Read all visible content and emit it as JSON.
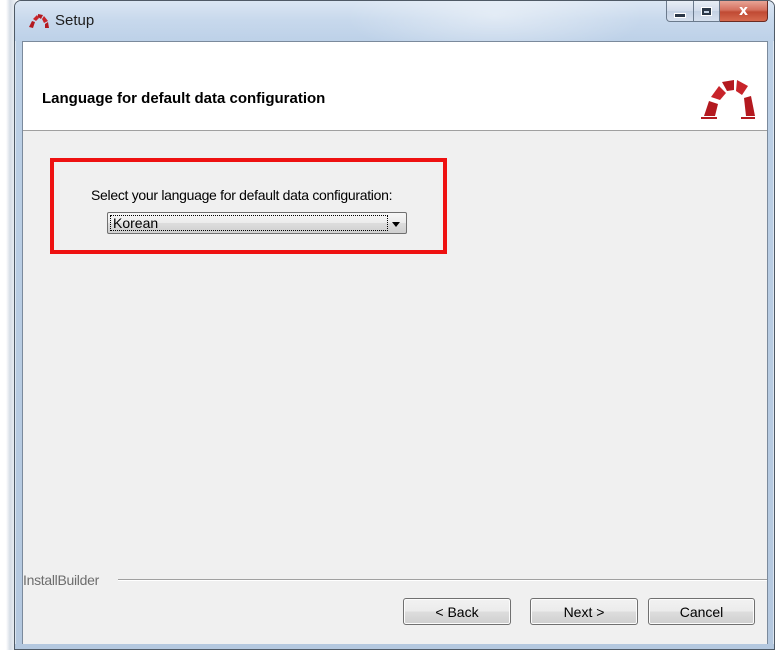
{
  "window": {
    "title": "Setup",
    "close_glyph": "x",
    "icon": "redmine-arc-icon"
  },
  "header": {
    "title": "Language for default data configuration",
    "logo_icon": "redmine-logo-icon"
  },
  "language_field": {
    "label": "Select your language for default data configuration:",
    "selected": "Korean"
  },
  "footer": {
    "brand": "InstallBuilder"
  },
  "buttons": {
    "back": "< Back",
    "next": "Next >",
    "cancel": "Cancel"
  },
  "colors": {
    "highlight": "#ee1111",
    "logo_red": "#b3191f",
    "client_bg": "#f0f0f0"
  }
}
